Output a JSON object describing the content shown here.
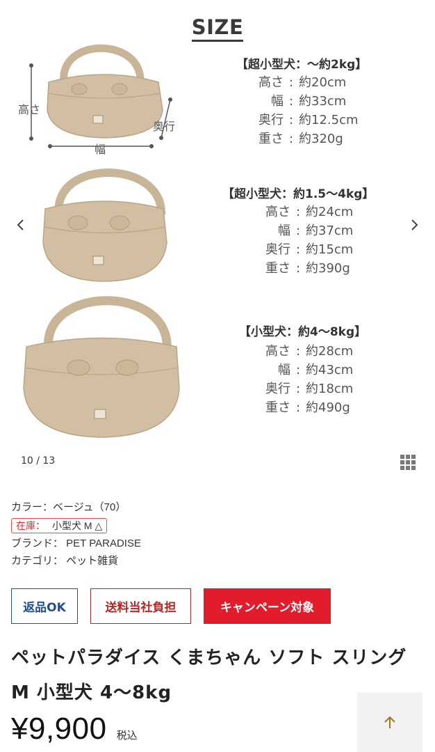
{
  "gallery": {
    "heading": "SIZE",
    "dimension_labels": {
      "height": "高さ",
      "width": "幅",
      "depth": "奥行"
    },
    "specs": [
      {
        "header": "【超小型犬：～約2kg】",
        "rows": [
          {
            "key": "高さ",
            "value": "約20cm"
          },
          {
            "key": "幅",
            "value": "約33cm"
          },
          {
            "key": "奥行",
            "value": "約12.5cm"
          },
          {
            "key": "重さ",
            "value": "約320g"
          }
        ]
      },
      {
        "header": "【超小型犬：約1.5～4kg】",
        "rows": [
          {
            "key": "高さ",
            "value": "約24cm"
          },
          {
            "key": "幅",
            "value": "約37cm"
          },
          {
            "key": "奥行",
            "value": "約15cm"
          },
          {
            "key": "重さ",
            "value": "約390g"
          }
        ]
      },
      {
        "header": "【小型犬：約4～8kg】",
        "rows": [
          {
            "key": "高さ",
            "value": "約28cm"
          },
          {
            "key": "幅",
            "value": "約43cm"
          },
          {
            "key": "奥行",
            "value": "約18cm"
          },
          {
            "key": "重さ",
            "value": "約490g"
          }
        ]
      }
    ],
    "counter": "10 / 13",
    "icons": {
      "prev": "chevron-left-icon",
      "next": "chevron-right-icon",
      "grid": "grid-icon"
    }
  },
  "product": {
    "color": "カラー：ベージュ（70）",
    "stock_label": "在庫：",
    "stock_value": "小型犬 M △",
    "brand": "ブランド： PET PARADISE",
    "category": "カテゴリ： ペット雑貨",
    "badges": {
      "return": "返品OK",
      "shipping": "送料当社負担",
      "campaign": "キャンペーン対象"
    },
    "title": "ペットパラダイス くまちゃん ソフト スリング M 小型犬 4〜8kg",
    "price": "¥9,900",
    "tax": "税込"
  },
  "colors": {
    "return_badge": "#1f4f8c",
    "shipping_badge": "#b02a2a",
    "campaign_badge": "#e21d2b",
    "bag": "#d2bea3",
    "scroll_top_bg": "#f2f2f2",
    "scroll_top_arrow": "#a0781e"
  }
}
